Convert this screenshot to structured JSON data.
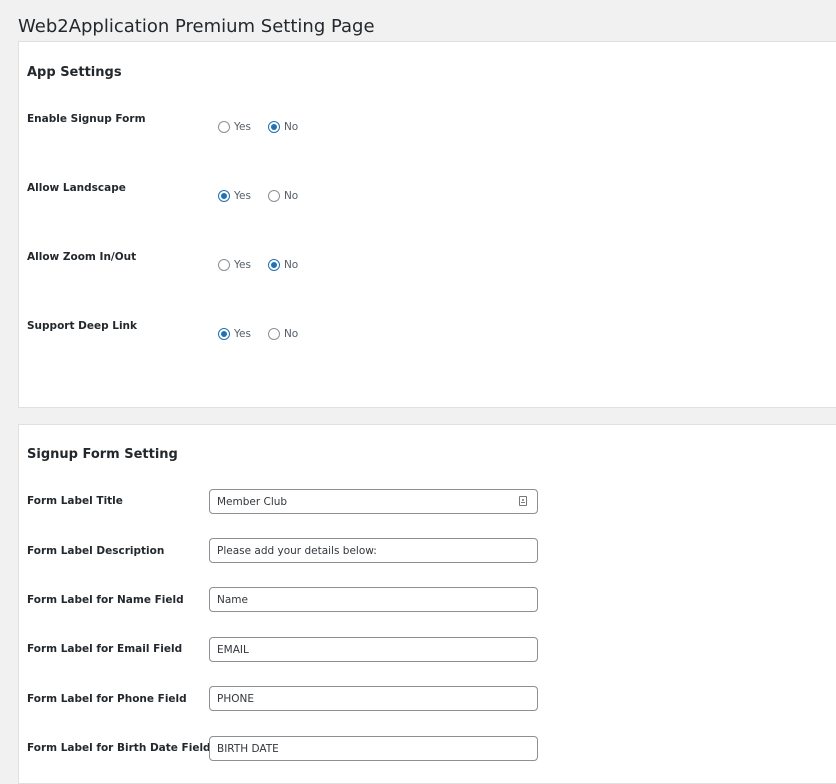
{
  "page": {
    "title": "Web2Application Premium Setting Page"
  },
  "app_settings": {
    "heading": "App Settings",
    "settings": [
      {
        "label": "Enable Signup Form",
        "yes_label": "Yes",
        "no_label": "No",
        "selected": "No"
      },
      {
        "label": "Allow Landscape",
        "yes_label": "Yes",
        "no_label": "No",
        "selected": "Yes"
      },
      {
        "label": "Allow Zoom In/Out",
        "yes_label": "Yes",
        "no_label": "No",
        "selected": "No"
      },
      {
        "label": "Support Deep Link",
        "yes_label": "Yes",
        "no_label": "No",
        "selected": "Yes"
      }
    ]
  },
  "signup_form": {
    "heading": "Signup Form Setting",
    "fields": [
      {
        "label": "Form Label Title",
        "value": "Member Club",
        "icon": "contact-card-icon"
      },
      {
        "label": "Form Label Description",
        "value": "Please add your details below:"
      },
      {
        "label": "Form Label for Name Field",
        "value": "Name"
      },
      {
        "label": "Form Label for Email Field",
        "value": "EMAIL"
      },
      {
        "label": "Form Label for Phone Field",
        "value": "PHONE"
      },
      {
        "label": "Form Label for Birth Date Field",
        "value": "BIRTH DATE"
      }
    ]
  },
  "colors": {
    "accent": "#2271b1",
    "background": "#f1f1f1",
    "panel": "#ffffff"
  }
}
